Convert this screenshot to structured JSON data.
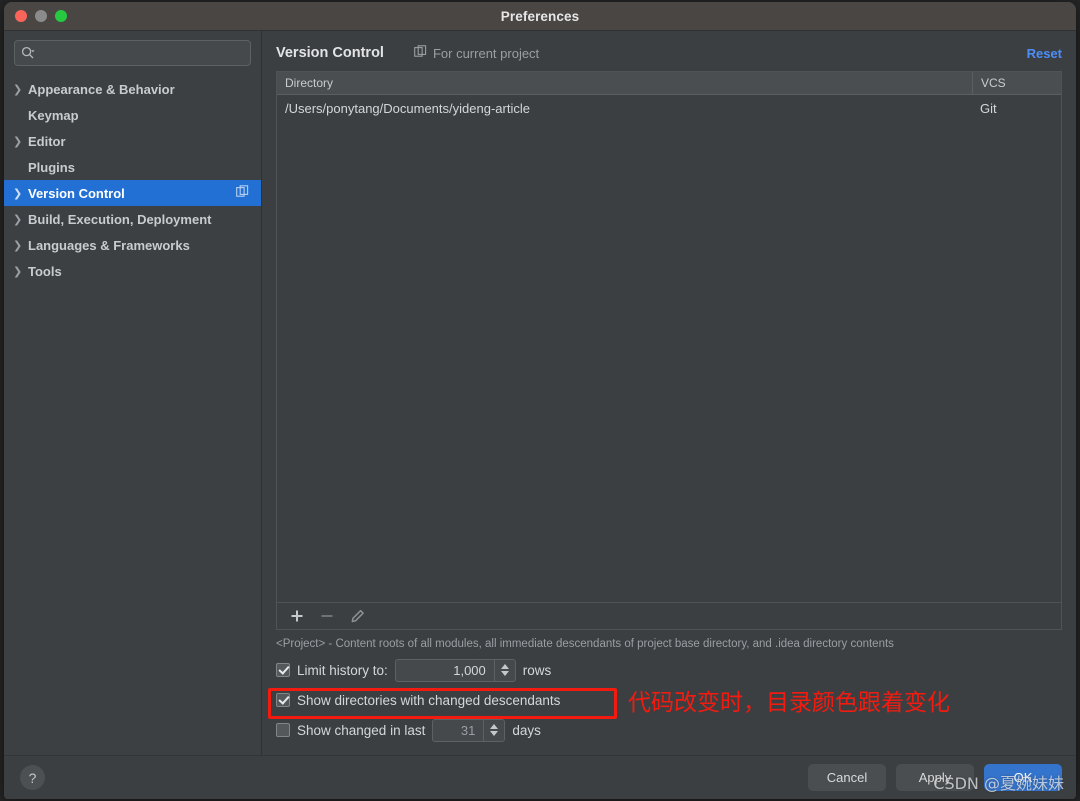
{
  "window": {
    "title": "Preferences",
    "traffic_lights": [
      "close-red",
      "minimize-gray",
      "zoom-green"
    ]
  },
  "sidebar": {
    "search": {
      "value": "",
      "placeholder": ""
    },
    "items": [
      {
        "label": "Appearance & Behavior",
        "expandable": true,
        "selected": false
      },
      {
        "label": "Keymap",
        "expandable": false,
        "selected": false
      },
      {
        "label": "Editor",
        "expandable": true,
        "selected": false
      },
      {
        "label": "Plugins",
        "expandable": false,
        "selected": false
      },
      {
        "label": "Version Control",
        "expandable": true,
        "selected": true
      },
      {
        "label": "Build, Execution, Deployment",
        "expandable": true,
        "selected": false
      },
      {
        "label": "Languages & Frameworks",
        "expandable": true,
        "selected": false
      },
      {
        "label": "Tools",
        "expandable": true,
        "selected": false
      }
    ]
  },
  "main": {
    "panel_title": "Version Control",
    "scope_label": "For current project",
    "reset_label": "Reset",
    "table": {
      "columns": [
        "Directory",
        "VCS"
      ],
      "rows": [
        {
          "directory": "/Users/ponytang/Documents/yideng-article",
          "vcs": "Git"
        }
      ]
    },
    "toolbar": {
      "add_label": "+",
      "remove_label": "−",
      "edit_label": "edit-pencil-icon"
    },
    "hint": "<Project> - Content roots of all modules, all immediate descendants of project base directory, and .idea directory contents",
    "options": {
      "limit_history": {
        "label": "Limit history to:",
        "checked": true,
        "value": "1,000",
        "suffix": "rows"
      },
      "show_directories": {
        "label": "Show directories with changed descendants",
        "checked": true
      },
      "show_changed_in_last": {
        "label": "Show changed in last",
        "checked": false,
        "value": "31",
        "suffix": "days"
      }
    }
  },
  "annotation": {
    "text": "代码改变时，目录颜色跟着变化",
    "color": "#f31b10"
  },
  "footer": {
    "help_label": "?",
    "cancel_label": "Cancel",
    "apply_label": "Apply",
    "ok_label": "OK"
  },
  "watermark": {
    "text": "CSDN @夏婉妹妹"
  },
  "colors": {
    "accent_selection": "#2270d4",
    "link": "#4c8ef7",
    "annotation_red": "#f31b10",
    "primary_button": "#3574cc",
    "window_bg": "#3c3f41",
    "sidebar_bg": "#3c4043",
    "titlebar_bg": "#4a4644"
  }
}
